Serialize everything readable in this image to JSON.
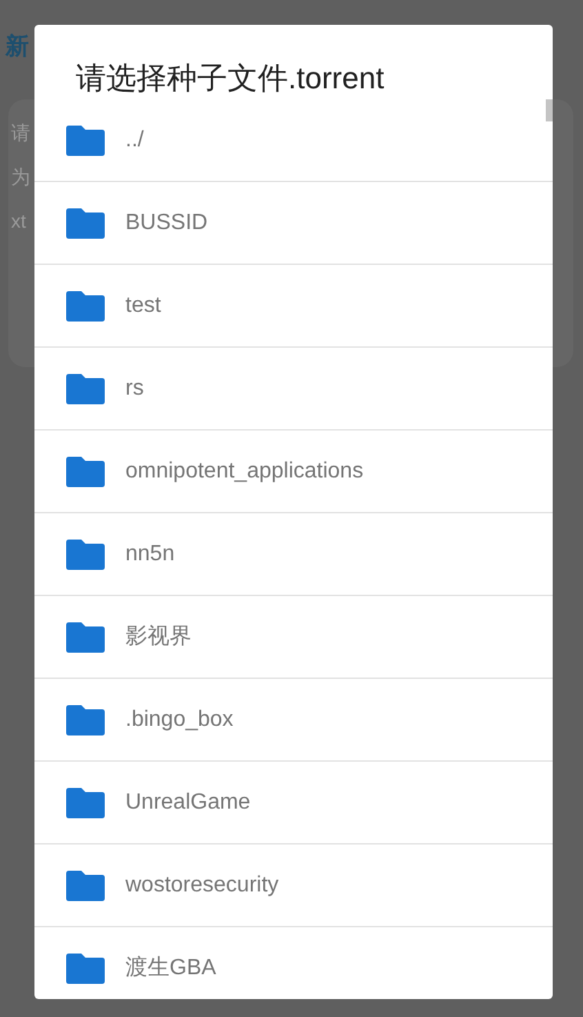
{
  "background": {
    "heading": "新",
    "card_lines": [
      "请",
      "为",
      "xt"
    ]
  },
  "dialog": {
    "title": "请选择种子文件.torrent",
    "items": [
      "../",
      "BUSSID",
      "test",
      "rs",
      "omnipotent_applications",
      "nn5n",
      "影视界",
      ".bingo_box",
      "UnrealGame",
      "wostoresecurity",
      "渡生GBA"
    ]
  }
}
